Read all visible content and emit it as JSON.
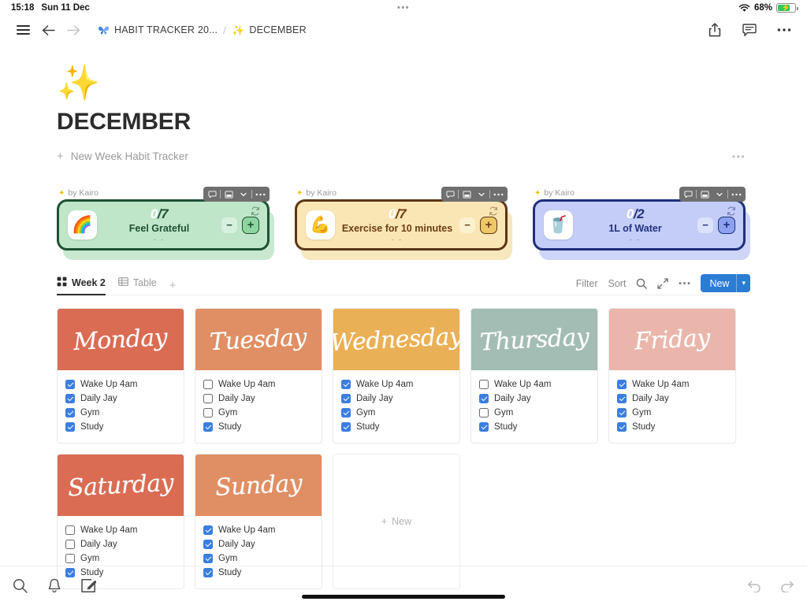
{
  "statusbar": {
    "time": "15:18",
    "date": "Sun 11 Dec",
    "center_dots": "•••",
    "battery_percent": "68%",
    "wifi_icon": "wifi-icon",
    "battery_icon": "battery-charging-icon"
  },
  "navbar": {
    "menu_icon": "hamburger-menu-icon",
    "back_icon": "arrow-left-icon",
    "forward_icon": "arrow-right-icon",
    "breadcrumb": [
      {
        "icon": "butterfly-icon",
        "label": "HABIT TRACKER 20..."
      },
      {
        "icon": "✨",
        "label": "DECEMBER"
      }
    ],
    "separator": "/",
    "share_icon": "share-icon",
    "comment_icon": "comment-icon",
    "more_icon": "more-horizontal-icon"
  },
  "page": {
    "cover_emoji": "✨",
    "title": "DECEMBER",
    "new_week_plus": "+",
    "new_week_label": "New Week Habit Tracker",
    "row_more": "•••"
  },
  "widgets": [
    {
      "byline": "by Kairo",
      "emoji": "🌈",
      "count": "0",
      "total": "/7",
      "label": "Feel Grateful",
      "dots": "- -",
      "minus": "−",
      "plus": "+",
      "sync_icon": "sync-icon",
      "colors": {
        "border": "#1f5134",
        "bg": "#bfe6c8",
        "text": "#1f5134",
        "btn_plus_bg": "#8fd5a2",
        "btn_minus_bg": "#d7f0de",
        "shadow": "#c8e9d0"
      }
    },
    {
      "byline": "by Kairo",
      "emoji": "💪",
      "count": "0",
      "total": "/7",
      "label": "Exercise for 10 minutes",
      "dots": "- -",
      "minus": "−",
      "plus": "+",
      "sync_icon": "sync-icon",
      "colors": {
        "border": "#5b3516",
        "bg": "#fae6b4",
        "text": "#6a3d17",
        "btn_plus_bg": "#eec868",
        "btn_minus_bg": "#fbf0cf",
        "shadow": "#f7e7bd"
      }
    },
    {
      "byline": "by Kairo",
      "emoji": "🥤",
      "count": "0",
      "total": "/2",
      "label": "1L of Water",
      "dots": "- -",
      "minus": "−",
      "plus": "+",
      "sync_icon": "sync-icon",
      "colors": {
        "border": "#1f2e7a",
        "bg": "#c3cdf7",
        "text": "#22307c",
        "btn_plus_bg": "#8ca2ee",
        "btn_minus_bg": "#dbe2fb",
        "shadow": "#cdd6f8"
      }
    }
  ],
  "widget_tools": {
    "comment_icon": "comment-icon",
    "layout_icon": "layout-icon",
    "chevron_icon": "chevron-down-icon",
    "more_icon": "more-horizontal-icon"
  },
  "db_toolbar": {
    "tabs": [
      {
        "icon": "gallery-view-icon",
        "label": "Week 2",
        "active": true
      },
      {
        "icon": "table-view-icon",
        "label": "Table",
        "active": false
      }
    ],
    "add_tab": "+",
    "filter_label": "Filter",
    "sort_label": "Sort",
    "search_icon": "search-icon",
    "expand_icon": "expand-icon",
    "more_icon": "more-horizontal-icon",
    "new_label": "New",
    "new_chevron": "▾"
  },
  "days": [
    {
      "name": "Monday",
      "banner_color": "#d96c53",
      "tasks": [
        {
          "label": "Wake Up 4am",
          "checked": true
        },
        {
          "label": "Daily Jay",
          "checked": true
        },
        {
          "label": "Gym",
          "checked": true
        },
        {
          "label": "Study",
          "checked": true
        }
      ]
    },
    {
      "name": "Tuesday",
      "banner_color": "#e08e63",
      "tasks": [
        {
          "label": "Wake Up 4am",
          "checked": false
        },
        {
          "label": "Daily Jay",
          "checked": false
        },
        {
          "label": "Gym",
          "checked": false
        },
        {
          "label": "Study",
          "checked": true
        }
      ]
    },
    {
      "name": "Wednesday",
      "banner_color": "#eab055",
      "tasks": [
        {
          "label": "Wake Up 4am",
          "checked": true
        },
        {
          "label": "Daily Jay",
          "checked": true
        },
        {
          "label": "Gym",
          "checked": true
        },
        {
          "label": "Study",
          "checked": true
        }
      ]
    },
    {
      "name": "Thursday",
      "banner_color": "#a3bdb4",
      "tasks": [
        {
          "label": "Wake Up 4am",
          "checked": false
        },
        {
          "label": "Daily Jay",
          "checked": true
        },
        {
          "label": "Gym",
          "checked": false
        },
        {
          "label": "Study",
          "checked": true
        }
      ]
    },
    {
      "name": "Friday",
      "banner_color": "#eab6ac",
      "tasks": [
        {
          "label": "Wake Up 4am",
          "checked": true
        },
        {
          "label": "Daily Jay",
          "checked": true
        },
        {
          "label": "Gym",
          "checked": true
        },
        {
          "label": "Study",
          "checked": true
        }
      ]
    },
    {
      "name": "Saturday",
      "banner_color": "#d96c53",
      "tasks": [
        {
          "label": "Wake Up 4am",
          "checked": false
        },
        {
          "label": "Daily Jay",
          "checked": false
        },
        {
          "label": "Gym",
          "checked": false
        },
        {
          "label": "Study",
          "checked": true
        }
      ]
    },
    {
      "name": "Sunday",
      "banner_color": "#e08e63",
      "tasks": [
        {
          "label": "Wake Up 4am",
          "checked": true
        },
        {
          "label": "Daily Jay",
          "checked": true
        },
        {
          "label": "Gym",
          "checked": true
        },
        {
          "label": "Study",
          "checked": true
        }
      ]
    }
  ],
  "new_card": {
    "plus": "+",
    "label": "New"
  },
  "bottombar": {
    "search_icon": "search-icon",
    "bell_icon": "bell-icon",
    "compose_icon": "compose-icon",
    "undo_icon": "undo-icon",
    "redo_icon": "redo-icon"
  }
}
